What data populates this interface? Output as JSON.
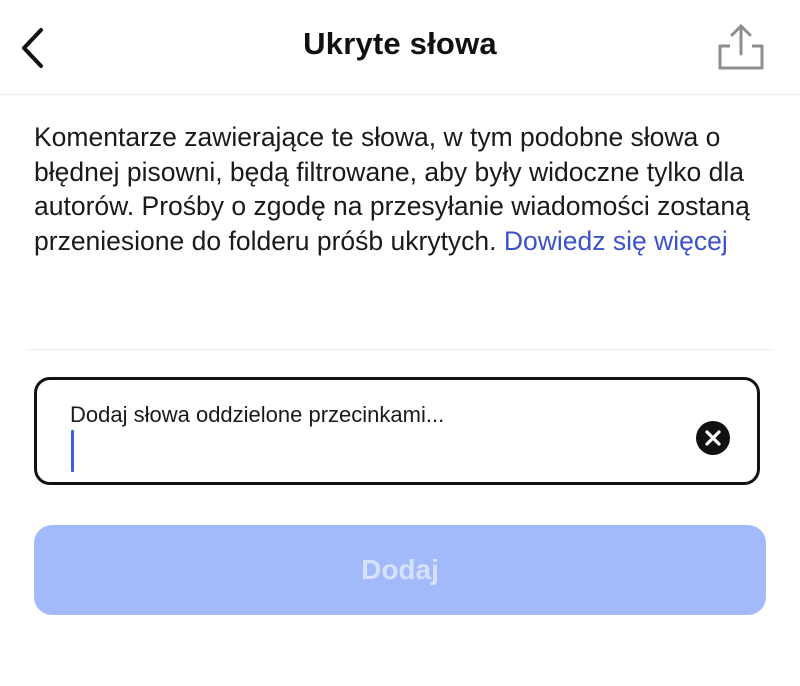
{
  "header": {
    "title": "Ukryte słowa",
    "back_icon": "chevron-left-icon",
    "share_icon": "share-icon"
  },
  "description": {
    "text": "Komentarze zawierające te słowa, w tym podobne słowa o błędnej pisowni, będą filtrowane, aby były widoczne tylko dla autorów. Prośby o zgodę na przesyłanie wiadomości zostaną przeniesione do folderu próśb ukrytych. ",
    "link_text": "Dowiedz się więcej"
  },
  "input": {
    "placeholder": "Dodaj słowa oddzielone przecinkami...",
    "value": "",
    "clear_icon": "clear-icon"
  },
  "add_button": {
    "label": "Dodaj",
    "disabled": true
  },
  "colors": {
    "link": "#3c52c8",
    "button_bg_disabled": "#a2baf9",
    "button_text_disabled": "#d6e1fc",
    "caret": "#3c5fe0"
  }
}
